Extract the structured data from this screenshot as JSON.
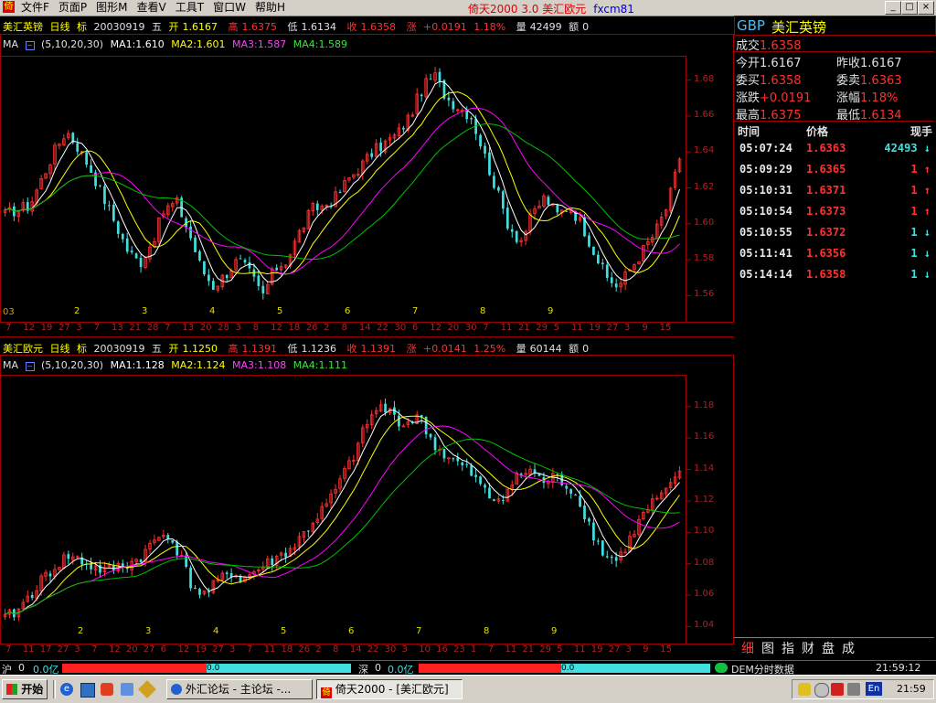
{
  "menubar": {
    "items": [
      "文件F",
      "页面P",
      "图形M",
      "查看V",
      "工具T",
      "窗口W",
      "帮助H"
    ],
    "window_title": "倚天2000 3.0 美汇欧元",
    "symbol_code": "fxcm81",
    "controls": [
      "_",
      "□",
      "×"
    ]
  },
  "chart1": {
    "name": "美汇英镑",
    "period": "日线",
    "mark": "标",
    "date": "20030919",
    "weekday": "五",
    "open_label": "开",
    "open": "1.6167",
    "high_label": "高",
    "high": "1.6375",
    "low_label": "低",
    "low": "1.6134",
    "close_label": "收",
    "close": "1.6358",
    "change_label": "涨",
    "change": "+0.0191",
    "change_pct": "1.18%",
    "volume_label": "量",
    "volume": "42499",
    "amount_label": "额",
    "amount": "0",
    "ma_label": "MA",
    "ma_params": "(5,10,20,30)",
    "ma1": "MA1:1.610",
    "ma2": "MA2:1.601",
    "ma3": "MA3:1.587",
    "ma4": "MA4:1.589",
    "year_label": "03",
    "month_labels": [
      "2",
      "3",
      "4",
      "5",
      "6",
      "7",
      "8",
      "9"
    ],
    "x_ticks": [
      "7",
      "12",
      "19",
      "27",
      "3",
      "7",
      "13",
      "21",
      "28",
      "7",
      "13",
      "20",
      "28",
      "3",
      "8",
      "12",
      "18",
      "26",
      "2",
      "8",
      "14",
      "22",
      "30",
      "6",
      "12",
      "20",
      "30",
      "7",
      "11",
      "21",
      "29",
      "5",
      "11",
      "19",
      "27",
      "3",
      "9",
      "15"
    ]
  },
  "chart2": {
    "name": "美汇欧元",
    "period": "日线",
    "mark": "标",
    "date": "20030919",
    "weekday": "五",
    "open_label": "开",
    "open": "1.1250",
    "high_label": "高",
    "high": "1.1391",
    "low_label": "低",
    "low": "1.1236",
    "close_label": "收",
    "close": "1.1391",
    "change_label": "涨",
    "change": "+0.0141",
    "change_pct": "1.25%",
    "volume_label": "量",
    "volume": "60144",
    "amount_label": "额",
    "amount": "0",
    "ma_label": "MA",
    "ma_params": "(5,10,20,30)",
    "ma1": "MA1:1.128",
    "ma2": "MA2:1.124",
    "ma3": "MA3:1.108",
    "ma4": "MA4:1.111",
    "month_labels": [
      "2",
      "3",
      "4",
      "5",
      "6",
      "7",
      "8",
      "9"
    ],
    "x_ticks": [
      "7",
      "11",
      "17",
      "27",
      "3",
      "7",
      "12",
      "20",
      "27",
      "6",
      "12",
      "19",
      "27",
      "3",
      "7",
      "11",
      "18",
      "26",
      "2",
      "8",
      "14",
      "22",
      "30",
      "3",
      "10",
      "16",
      "23",
      "1",
      "7",
      "11",
      "21",
      "29",
      "5",
      "11",
      "19",
      "27",
      "3",
      "9",
      "15"
    ]
  },
  "chart_data": [
    {
      "type": "candlestick",
      "title": "美汇英镑 日线",
      "ylim": [
        1.55,
        1.69
      ],
      "y_ticks": [
        "1.68",
        "1.66",
        "1.64",
        "1.62",
        "1.60",
        "1.58",
        "1.56"
      ],
      "y_tick_values": [
        1.68,
        1.66,
        1.64,
        1.62,
        1.6,
        1.58,
        1.56
      ],
      "keypoints": [
        1.605,
        1.608,
        1.61,
        1.625,
        1.64,
        1.652,
        1.642,
        1.63,
        1.615,
        1.6,
        1.585,
        1.578,
        1.59,
        1.608,
        1.612,
        1.595,
        1.575,
        1.565,
        1.572,
        1.58,
        1.572,
        1.56,
        1.575,
        1.58,
        1.595,
        1.608,
        1.61,
        1.615,
        1.625,
        1.632,
        1.64,
        1.645,
        1.65,
        1.66,
        1.675,
        1.683,
        1.67,
        1.665,
        1.66,
        1.64,
        1.62,
        1.6,
        1.59,
        1.605,
        1.615,
        1.605,
        1.61,
        1.6,
        1.585,
        1.57,
        1.565,
        1.575,
        1.585,
        1.595,
        1.61,
        1.636
      ],
      "ma_last": [
        1.61,
        1.601,
        1.587,
        1.589
      ]
    },
    {
      "type": "candlestick",
      "title": "美汇欧元 日线",
      "ylim": [
        1.035,
        1.195
      ],
      "y_ticks": [
        "1.18",
        "1.16",
        "1.14",
        "1.12",
        "1.10",
        "1.08",
        "1.06",
        "1.04"
      ],
      "y_tick_values": [
        1.18,
        1.16,
        1.14,
        1.12,
        1.1,
        1.08,
        1.06,
        1.04
      ],
      "keypoints": [
        1.045,
        1.05,
        1.06,
        1.07,
        1.078,
        1.085,
        1.082,
        1.078,
        1.075,
        1.078,
        1.08,
        1.085,
        1.095,
        1.1,
        1.085,
        1.065,
        1.06,
        1.068,
        1.075,
        1.07,
        1.075,
        1.08,
        1.085,
        1.09,
        1.1,
        1.11,
        1.12,
        1.135,
        1.15,
        1.17,
        1.18,
        1.175,
        1.168,
        1.175,
        1.16,
        1.15,
        1.145,
        1.14,
        1.13,
        1.12,
        1.125,
        1.135,
        1.14,
        1.132,
        1.135,
        1.13,
        1.12,
        1.1,
        1.085,
        1.082,
        1.095,
        1.11,
        1.12,
        1.125,
        1.139
      ],
      "ma_last": [
        1.128,
        1.124,
        1.108,
        1.111
      ]
    }
  ],
  "quote": {
    "symbol": "GBP",
    "name": "美汇英镑",
    "rows": [
      {
        "l1": "成交",
        "v1": "1.6358",
        "l2": "",
        "v2": ""
      },
      {
        "l1": "今开",
        "v1": "1.6167",
        "l2": "昨收",
        "v2": "1.6167"
      },
      {
        "l1": "委买",
        "v1": "1.6358",
        "l2": "委卖",
        "v2": "1.6363"
      },
      {
        "l1": "涨跌",
        "v1": "+0.0191",
        "l2": "涨幅",
        "v2": "1.18%"
      },
      {
        "l1": "最高",
        "v1": "1.6375",
        "l2": "最低",
        "v2": "1.6134"
      }
    ],
    "trade_header": {
      "time": "时间",
      "price": "价格",
      "vol": "现手"
    },
    "trades": [
      {
        "time": "05:07:24",
        "price": "1.6363",
        "vol": "42493",
        "dir": "down",
        "arrow": "↓"
      },
      {
        "time": "05:09:29",
        "price": "1.6365",
        "vol": "1",
        "dir": "up",
        "arrow": "↑"
      },
      {
        "time": "05:10:31",
        "price": "1.6371",
        "vol": "1",
        "dir": "up",
        "arrow": "↑"
      },
      {
        "time": "05:10:54",
        "price": "1.6373",
        "vol": "1",
        "dir": "up",
        "arrow": "↑"
      },
      {
        "time": "05:10:55",
        "price": "1.6372",
        "vol": "1",
        "dir": "down",
        "arrow": "↓"
      },
      {
        "time": "05:11:41",
        "price": "1.6356",
        "vol": "1",
        "dir": "down",
        "arrow": "↓"
      },
      {
        "time": "05:14:14",
        "price": "1.6358",
        "vol": "1",
        "dir": "down",
        "arrow": "↓"
      }
    ],
    "tabs": [
      "细",
      "图",
      "指",
      "财",
      "盘",
      "成"
    ]
  },
  "status": {
    "sh_label": "沪",
    "sh_value": "0",
    "sh_amount": "0.0亿",
    "sh_bar": "0.0",
    "sz_label": "深",
    "sz_value": "0",
    "sz_amount": "0.0亿",
    "sz_bar": "0.0",
    "dem": "DEM分时数据",
    "time": "21:59:12"
  },
  "taskbar": {
    "start": "开始",
    "tasks": [
      "外汇论坛 - 主论坛 -...",
      "倚天2000 - [美汇欧元]"
    ],
    "lang": "En",
    "clock": "21:59"
  },
  "colors": {
    "panel_border": "#a00000",
    "up_candle": "#ff3030",
    "down_candle": "#40e0e0",
    "ma1": "#ffffff",
    "ma2": "#ffff00",
    "ma3": "#ff00ff",
    "ma4": "#00c000",
    "month_text": "#e0e000"
  }
}
